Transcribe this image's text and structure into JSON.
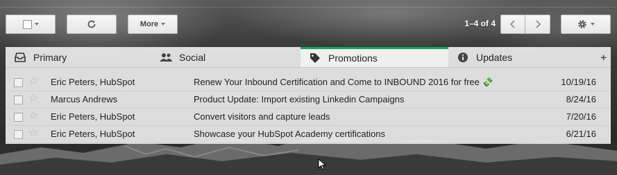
{
  "toolbar": {
    "more_label": "More",
    "page_count": "1–4 of 4"
  },
  "tabs": [
    {
      "label": "Primary",
      "icon": "inbox-icon"
    },
    {
      "label": "Social",
      "icon": "people-icon"
    },
    {
      "label": "Promotions",
      "icon": "tag-icon",
      "active": true
    },
    {
      "label": "Updates",
      "icon": "info-icon"
    }
  ],
  "accent_color": "#16a765",
  "emails": [
    {
      "sender": "Eric Peters, HubSpot",
      "subject": "Renew Your Inbound Certification and Come to INBOUND 2016 for free",
      "emoji": "💸",
      "date": "10/19/16"
    },
    {
      "sender": "Marcus Andrews",
      "subject": "Product Update: Import existing Linkedin Campaigns",
      "date": "8/24/16"
    },
    {
      "sender": "Eric Peters, HubSpot",
      "subject": "Convert visitors and capture leads",
      "date": "7/20/16"
    },
    {
      "sender": "Eric Peters, HubSpot",
      "subject": "Showcase your HubSpot Academy certifications",
      "date": "6/21/16"
    }
  ]
}
